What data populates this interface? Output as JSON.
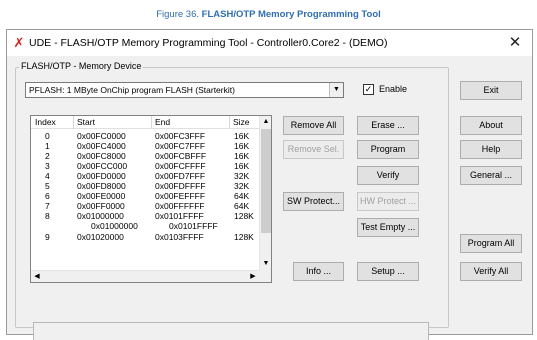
{
  "figure": {
    "number": "Figure 36.",
    "title": "FLASH/OTP Memory Programming Tool"
  },
  "window": {
    "title": "UDE - FLASH/OTP Memory Programming Tool  - Controller0.Core2 - (DEMO)",
    "close": "✕"
  },
  "group": {
    "label": "FLASH/OTP - Memory Device"
  },
  "device": {
    "selected": "PFLASH: 1 MByte OnChip program FLASH (Starterkit)",
    "arrow": "▼"
  },
  "enable": {
    "checked_mark": "✓",
    "label": "Enable"
  },
  "list": {
    "columns": [
      "Index",
      "Start",
      "End",
      "Size"
    ],
    "rows": [
      {
        "index": "0",
        "start": "0x00FC0000",
        "end": "0x00FC3FFF",
        "size": "16K"
      },
      {
        "index": "1",
        "start": "0x00FC4000",
        "end": "0x00FC7FFF",
        "size": "16K"
      },
      {
        "index": "2",
        "start": "0x00FC8000",
        "end": "0x00FCBFFF",
        "size": "16K"
      },
      {
        "index": "3",
        "start": "0x00FCC000",
        "end": "0x00FCFFFF",
        "size": "16K"
      },
      {
        "index": "4",
        "start": "0x00FD0000",
        "end": "0x00FD7FFF",
        "size": "32K"
      },
      {
        "index": "5",
        "start": "0x00FD8000",
        "end": "0x00FDFFFF",
        "size": "32K"
      },
      {
        "index": "6",
        "start": "0x00FE0000",
        "end": "0x00FEFFFF",
        "size": "64K"
      },
      {
        "index": "7",
        "start": "0x00FF0000",
        "end": "0x00FFFFFF",
        "size": "64K"
      },
      {
        "index": "8",
        "start": "0x01000000",
        "end": "0x0101FFFF",
        "size": "128K"
      },
      {
        "index": "",
        "start": "0x01000000",
        "end": "0x0101FFFF",
        "size": ""
      },
      {
        "index": "9",
        "start": "0x01020000",
        "end": "0x0103FFFF",
        "size": "128K"
      }
    ],
    "scroll_up": "▲",
    "scroll_down": "▼",
    "scroll_left": "◀",
    "scroll_right": "▶"
  },
  "buttons": {
    "remove_all": "Remove All",
    "remove_sel": "Remove Sel.",
    "sw_protect": "SW Protect...",
    "info": "Info ...",
    "erase": "Erase ...",
    "program": "Program",
    "verify": "Verify",
    "hw_protect": "HW Protect ...",
    "test_empty": "Test Empty ...",
    "setup": "Setup ...",
    "exit": "Exit",
    "about": "About",
    "help": "Help",
    "general": "General ...",
    "program_all": "Program All",
    "verify_all": "Verify All"
  },
  "colors": {
    "caption": "#2f6fb0",
    "icon": "#d0231e"
  },
  "icons": {
    "app": "ude-logo-icon"
  }
}
